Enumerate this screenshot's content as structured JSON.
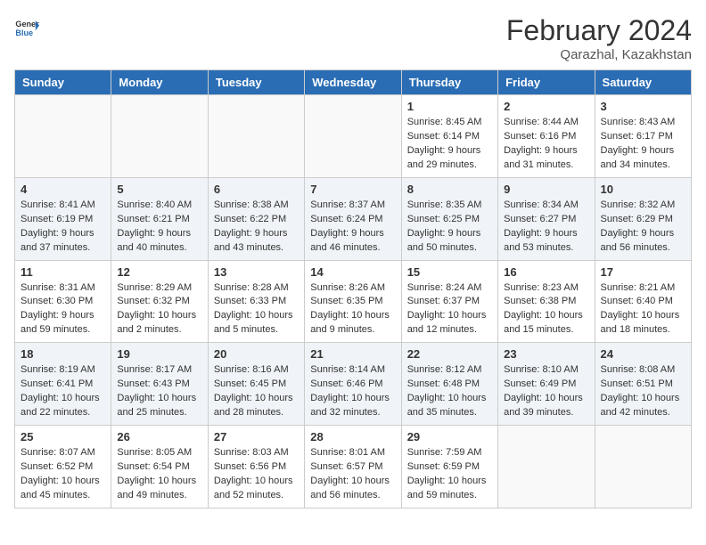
{
  "header": {
    "logo_general": "General",
    "logo_blue": "Blue",
    "month_year": "February 2024",
    "location": "Qarazhal, Kazakhstan"
  },
  "weekdays": [
    "Sunday",
    "Monday",
    "Tuesday",
    "Wednesday",
    "Thursday",
    "Friday",
    "Saturday"
  ],
  "weeks": [
    [
      {
        "day": "",
        "info": ""
      },
      {
        "day": "",
        "info": ""
      },
      {
        "day": "",
        "info": ""
      },
      {
        "day": "",
        "info": ""
      },
      {
        "day": "1",
        "info": "Sunrise: 8:45 AM\nSunset: 6:14 PM\nDaylight: 9 hours and 29 minutes."
      },
      {
        "day": "2",
        "info": "Sunrise: 8:44 AM\nSunset: 6:16 PM\nDaylight: 9 hours and 31 minutes."
      },
      {
        "day": "3",
        "info": "Sunrise: 8:43 AM\nSunset: 6:17 PM\nDaylight: 9 hours and 34 minutes."
      }
    ],
    [
      {
        "day": "4",
        "info": "Sunrise: 8:41 AM\nSunset: 6:19 PM\nDaylight: 9 hours and 37 minutes."
      },
      {
        "day": "5",
        "info": "Sunrise: 8:40 AM\nSunset: 6:21 PM\nDaylight: 9 hours and 40 minutes."
      },
      {
        "day": "6",
        "info": "Sunrise: 8:38 AM\nSunset: 6:22 PM\nDaylight: 9 hours and 43 minutes."
      },
      {
        "day": "7",
        "info": "Sunrise: 8:37 AM\nSunset: 6:24 PM\nDaylight: 9 hours and 46 minutes."
      },
      {
        "day": "8",
        "info": "Sunrise: 8:35 AM\nSunset: 6:25 PM\nDaylight: 9 hours and 50 minutes."
      },
      {
        "day": "9",
        "info": "Sunrise: 8:34 AM\nSunset: 6:27 PM\nDaylight: 9 hours and 53 minutes."
      },
      {
        "day": "10",
        "info": "Sunrise: 8:32 AM\nSunset: 6:29 PM\nDaylight: 9 hours and 56 minutes."
      }
    ],
    [
      {
        "day": "11",
        "info": "Sunrise: 8:31 AM\nSunset: 6:30 PM\nDaylight: 9 hours and 59 minutes."
      },
      {
        "day": "12",
        "info": "Sunrise: 8:29 AM\nSunset: 6:32 PM\nDaylight: 10 hours and 2 minutes."
      },
      {
        "day": "13",
        "info": "Sunrise: 8:28 AM\nSunset: 6:33 PM\nDaylight: 10 hours and 5 minutes."
      },
      {
        "day": "14",
        "info": "Sunrise: 8:26 AM\nSunset: 6:35 PM\nDaylight: 10 hours and 9 minutes."
      },
      {
        "day": "15",
        "info": "Sunrise: 8:24 AM\nSunset: 6:37 PM\nDaylight: 10 hours and 12 minutes."
      },
      {
        "day": "16",
        "info": "Sunrise: 8:23 AM\nSunset: 6:38 PM\nDaylight: 10 hours and 15 minutes."
      },
      {
        "day": "17",
        "info": "Sunrise: 8:21 AM\nSunset: 6:40 PM\nDaylight: 10 hours and 18 minutes."
      }
    ],
    [
      {
        "day": "18",
        "info": "Sunrise: 8:19 AM\nSunset: 6:41 PM\nDaylight: 10 hours and 22 minutes."
      },
      {
        "day": "19",
        "info": "Sunrise: 8:17 AM\nSunset: 6:43 PM\nDaylight: 10 hours and 25 minutes."
      },
      {
        "day": "20",
        "info": "Sunrise: 8:16 AM\nSunset: 6:45 PM\nDaylight: 10 hours and 28 minutes."
      },
      {
        "day": "21",
        "info": "Sunrise: 8:14 AM\nSunset: 6:46 PM\nDaylight: 10 hours and 32 minutes."
      },
      {
        "day": "22",
        "info": "Sunrise: 8:12 AM\nSunset: 6:48 PM\nDaylight: 10 hours and 35 minutes."
      },
      {
        "day": "23",
        "info": "Sunrise: 8:10 AM\nSunset: 6:49 PM\nDaylight: 10 hours and 39 minutes."
      },
      {
        "day": "24",
        "info": "Sunrise: 8:08 AM\nSunset: 6:51 PM\nDaylight: 10 hours and 42 minutes."
      }
    ],
    [
      {
        "day": "25",
        "info": "Sunrise: 8:07 AM\nSunset: 6:52 PM\nDaylight: 10 hours and 45 minutes."
      },
      {
        "day": "26",
        "info": "Sunrise: 8:05 AM\nSunset: 6:54 PM\nDaylight: 10 hours and 49 minutes."
      },
      {
        "day": "27",
        "info": "Sunrise: 8:03 AM\nSunset: 6:56 PM\nDaylight: 10 hours and 52 minutes."
      },
      {
        "day": "28",
        "info": "Sunrise: 8:01 AM\nSunset: 6:57 PM\nDaylight: 10 hours and 56 minutes."
      },
      {
        "day": "29",
        "info": "Sunrise: 7:59 AM\nSunset: 6:59 PM\nDaylight: 10 hours and 59 minutes."
      },
      {
        "day": "",
        "info": ""
      },
      {
        "day": "",
        "info": ""
      }
    ]
  ]
}
